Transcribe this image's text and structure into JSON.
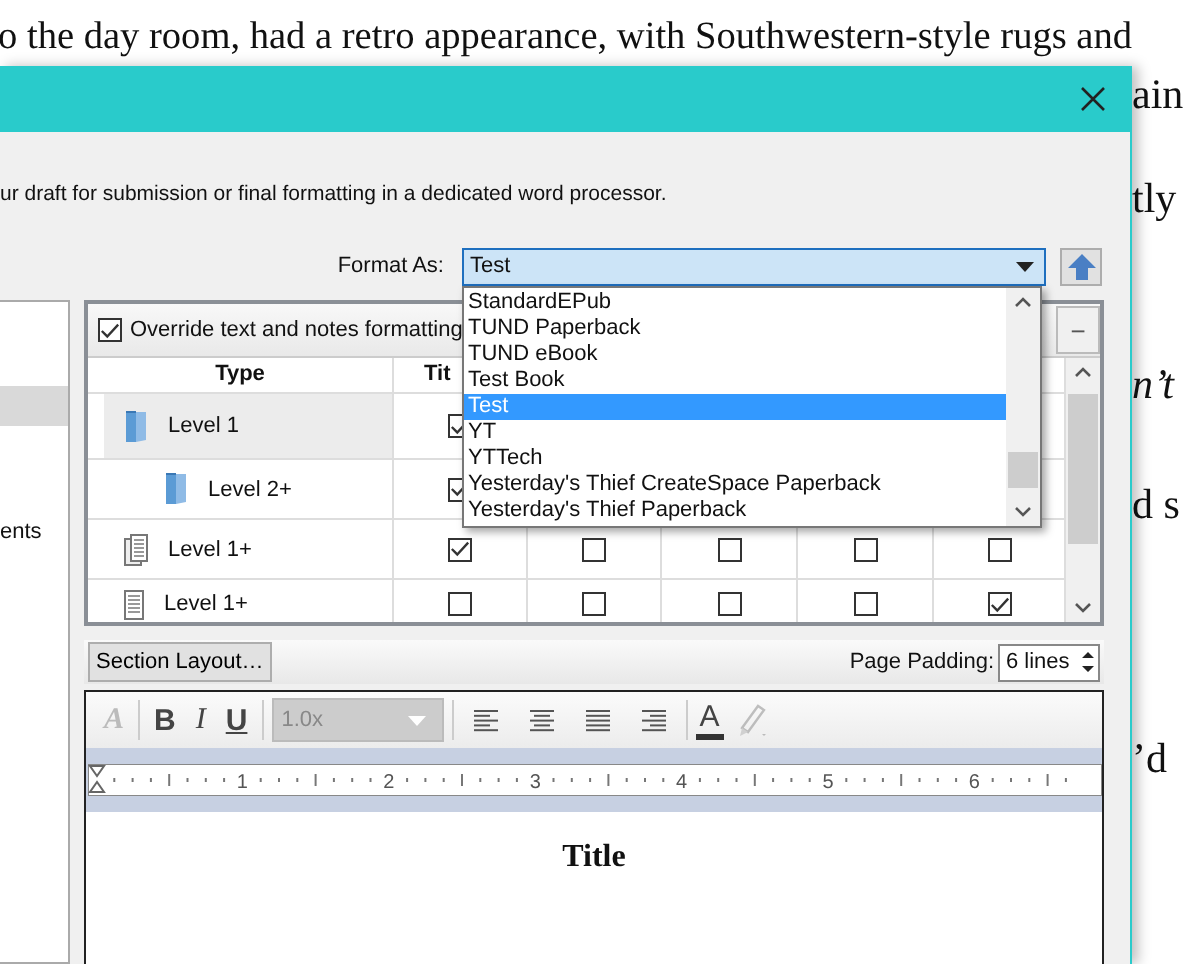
{
  "background_document": {
    "lines": [
      {
        "text": "o the day room, had a retro appearance, with Southwestern-style rugs and",
        "italic": false
      },
      {
        "text": "ain",
        "italic": false
      },
      {
        "text": "tly",
        "italic": false
      },
      {
        "text": "n’t",
        "italic": true
      },
      {
        "text": "d s",
        "italic": false
      },
      {
        "text": "’d",
        "italic": false
      }
    ]
  },
  "dialog": {
    "description": "ur draft for submission or final formatting in a dedicated word processor.",
    "format_as": {
      "label": "Format As:",
      "value": "Test",
      "expanded": true,
      "options": [
        {
          "label": "StandardEPub",
          "selected": false
        },
        {
          "label": "TUND Paperback",
          "selected": false
        },
        {
          "label": "TUND eBook",
          "selected": false
        },
        {
          "label": "Test Book",
          "selected": false
        },
        {
          "label": "Test",
          "selected": true
        },
        {
          "label": "YT",
          "selected": false
        },
        {
          "label": "YTTech",
          "selected": false
        },
        {
          "label": "Yesterday's Thief CreateSpace Paperback",
          "selected": false
        },
        {
          "label": "Yesterday's Thief Paperback",
          "selected": false
        }
      ]
    },
    "sidebar": {
      "items": [
        {
          "selected": true
        },
        {
          "label": "ents",
          "selected": false
        }
      ]
    },
    "override": {
      "label": "Override text and notes formatting",
      "checked": true
    },
    "remove_button": "−",
    "table": {
      "columns": [
        "Type",
        "Tit"
      ],
      "rows": [
        {
          "label": "Level 1",
          "kind": "folder",
          "selected": true,
          "cells": [
            {
              "checked": true
            }
          ],
          "children": [
            {
              "label": "Level 2+",
              "kind": "folder",
              "selected": false,
              "cells": [
                {
                  "checked": true
                }
              ]
            }
          ]
        },
        {
          "label": "Level 1+",
          "kind": "stack",
          "selected": false,
          "cells": [
            {
              "checked": true
            },
            {
              "checked": false
            },
            {
              "checked": false
            },
            {
              "checked": false
            },
            {
              "checked": false
            }
          ]
        },
        {
          "label": "Level 1+",
          "kind": "document",
          "selected": false,
          "cells": [
            {
              "checked": false
            },
            {
              "checked": false
            },
            {
              "checked": false
            },
            {
              "checked": false
            },
            {
              "checked": true
            }
          ]
        }
      ]
    },
    "section_layout": "Section Layout…",
    "page_padding": {
      "label": "Page Padding:",
      "value": "6 lines"
    },
    "editor": {
      "toolbar": [
        {
          "kind": "clear",
          "label": "A",
          "disabled": true
        },
        {
          "kind": "separator"
        },
        {
          "kind": "bold",
          "label": "B",
          "disabled": false
        },
        {
          "kind": "italic",
          "label": "I",
          "disabled": false
        },
        {
          "kind": "underline",
          "label": "U",
          "disabled": false
        },
        {
          "kind": "separator"
        },
        {
          "kind": "spacing",
          "label": "1.0x",
          "disabled": true
        },
        {
          "kind": "separator"
        },
        {
          "kind": "align-left"
        },
        {
          "kind": "align-center"
        },
        {
          "kind": "align-justify"
        },
        {
          "kind": "align-right"
        },
        {
          "kind": "separator"
        },
        {
          "kind": "font-color",
          "label": "A",
          "disabled": false
        },
        {
          "kind": "highlight",
          "disabled": true
        }
      ],
      "ruler": [
        "1",
        "2",
        "3",
        "4",
        "5",
        "6"
      ],
      "content": "Title"
    }
  }
}
